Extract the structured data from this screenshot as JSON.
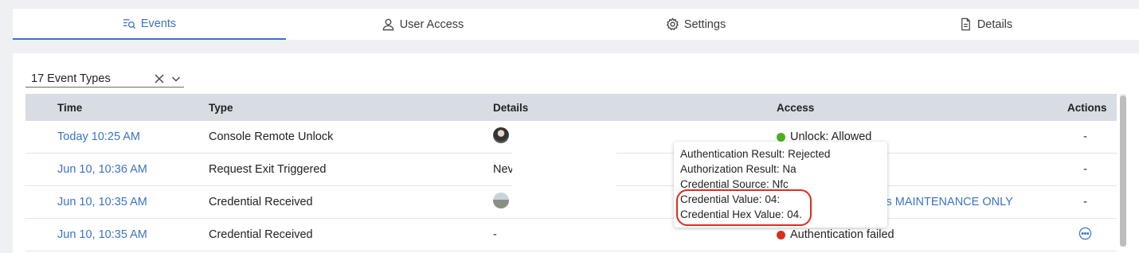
{
  "tabs": [
    {
      "label": "Events",
      "icon": "events-search-icon",
      "active": true
    },
    {
      "label": "User Access",
      "icon": "user-icon",
      "active": false
    },
    {
      "label": "Settings",
      "icon": "gear-icon",
      "active": false
    },
    {
      "label": "Details",
      "icon": "document-icon",
      "active": false
    }
  ],
  "filter": {
    "value": "17 Event Types"
  },
  "table": {
    "headers": {
      "time": "Time",
      "type": "Type",
      "details": "Details",
      "access": "Access",
      "actions": "Actions"
    },
    "rows": [
      {
        "time": "Today 10:25 AM",
        "type": "Console Remote Unlock",
        "details": "",
        "access": "Unlock: Allowed",
        "access_color": "#4caf1e",
        "actions": "-"
      },
      {
        "time": "Jun 10, 10:36 AM",
        "type": "Request Exit Triggered",
        "details": "Nev",
        "access": "",
        "actions": "-"
      },
      {
        "time": "Jun 10, 10:35 AM",
        "type": "Credential Received",
        "details": "",
        "access": "cks MAINTENANCE ONLY",
        "actions": "-"
      },
      {
        "time": "Jun 10, 10:35 AM",
        "type": "Credential Received",
        "details": "-",
        "access": "Authentication failed",
        "access_color": "#d6311f",
        "actions": ""
      }
    ]
  },
  "tooltip": {
    "lines": [
      "Authentication Result: Rejected",
      "Authorization Result: Na",
      "Credential Source: Nfc",
      "Credential Value: 04:",
      "Credential Hex Value: 04."
    ]
  },
  "colors": {
    "accent": "#3b73c9",
    "highlight": "#e02b1c"
  }
}
